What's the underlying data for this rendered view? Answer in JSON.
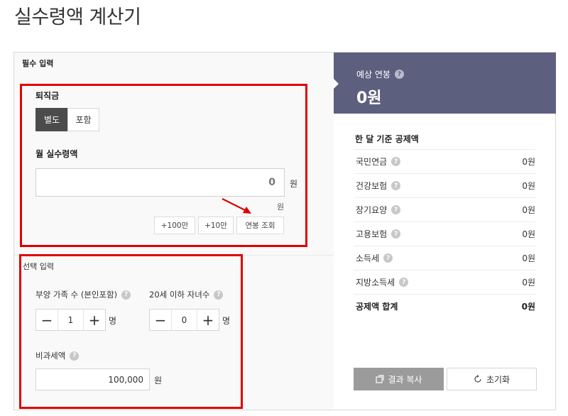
{
  "page": {
    "title": "실수령액 계산기"
  },
  "required": {
    "section_label": "필수 입력",
    "severance": {
      "label": "퇴직금",
      "options": [
        "별도",
        "포함"
      ],
      "selected": "별도"
    },
    "monthly": {
      "label": "월 실수령액",
      "value": "0",
      "unit": "원",
      "helper_unit": "원",
      "buttons": [
        "+100만",
        "+10만",
        "연봉 조회"
      ]
    }
  },
  "optional": {
    "section_label": "선택 입력",
    "dependents": {
      "label": "부양 가족 수 (본인포함)",
      "value": "1",
      "unit": "명"
    },
    "children": {
      "label": "20세 이하 자녀수",
      "value": "0",
      "unit": "명"
    },
    "nontax": {
      "label": "비과세액",
      "value": "100,000",
      "unit": "원"
    }
  },
  "result": {
    "header_label": "예상 연봉",
    "header_value": "0원",
    "deduction_title": "한 달 기준 공제액",
    "rows": [
      {
        "name": "국민연금",
        "value": "0원"
      },
      {
        "name": "건강보험",
        "value": "0원"
      },
      {
        "name": "장기요양",
        "value": "0원"
      },
      {
        "name": "고용보험",
        "value": "0원"
      },
      {
        "name": "소득세",
        "value": "0원"
      },
      {
        "name": "지방소득세",
        "value": "0원"
      }
    ],
    "total": {
      "name": "공제액 합계",
      "value": "0원"
    },
    "copy_label": "결과 복사",
    "reset_label": "초기화"
  },
  "icons": {
    "help": "?",
    "minus": "−",
    "plus": "+"
  },
  "colors": {
    "header_bg": "#5d5f7e",
    "annotation_red": "#e00000",
    "active_toggle": "#4b4b4b"
  }
}
